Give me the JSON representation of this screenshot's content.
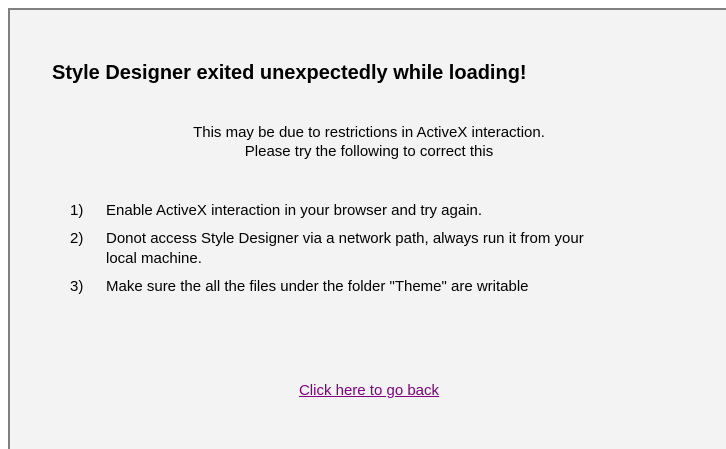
{
  "dialog": {
    "title": "Style Designer exited unexpectedly while loading!",
    "intro_line1": "This may be due to restrictions in ActiveX interaction.",
    "intro_line2": "Please try the following to correct this",
    "steps": [
      {
        "number": "1)",
        "text": "Enable ActiveX interaction in your browser and try again."
      },
      {
        "number": "2)",
        "text": "Donot access Style Designer via a network path, always run it from your local machine."
      },
      {
        "number": "3)",
        "text": "Make sure the all the files under the folder \"Theme\" are writable"
      }
    ],
    "back_link": "Click here to go back",
    "colors": {
      "background": "#f3f3f3",
      "border": "#808080",
      "link_visited": "#800080"
    }
  }
}
